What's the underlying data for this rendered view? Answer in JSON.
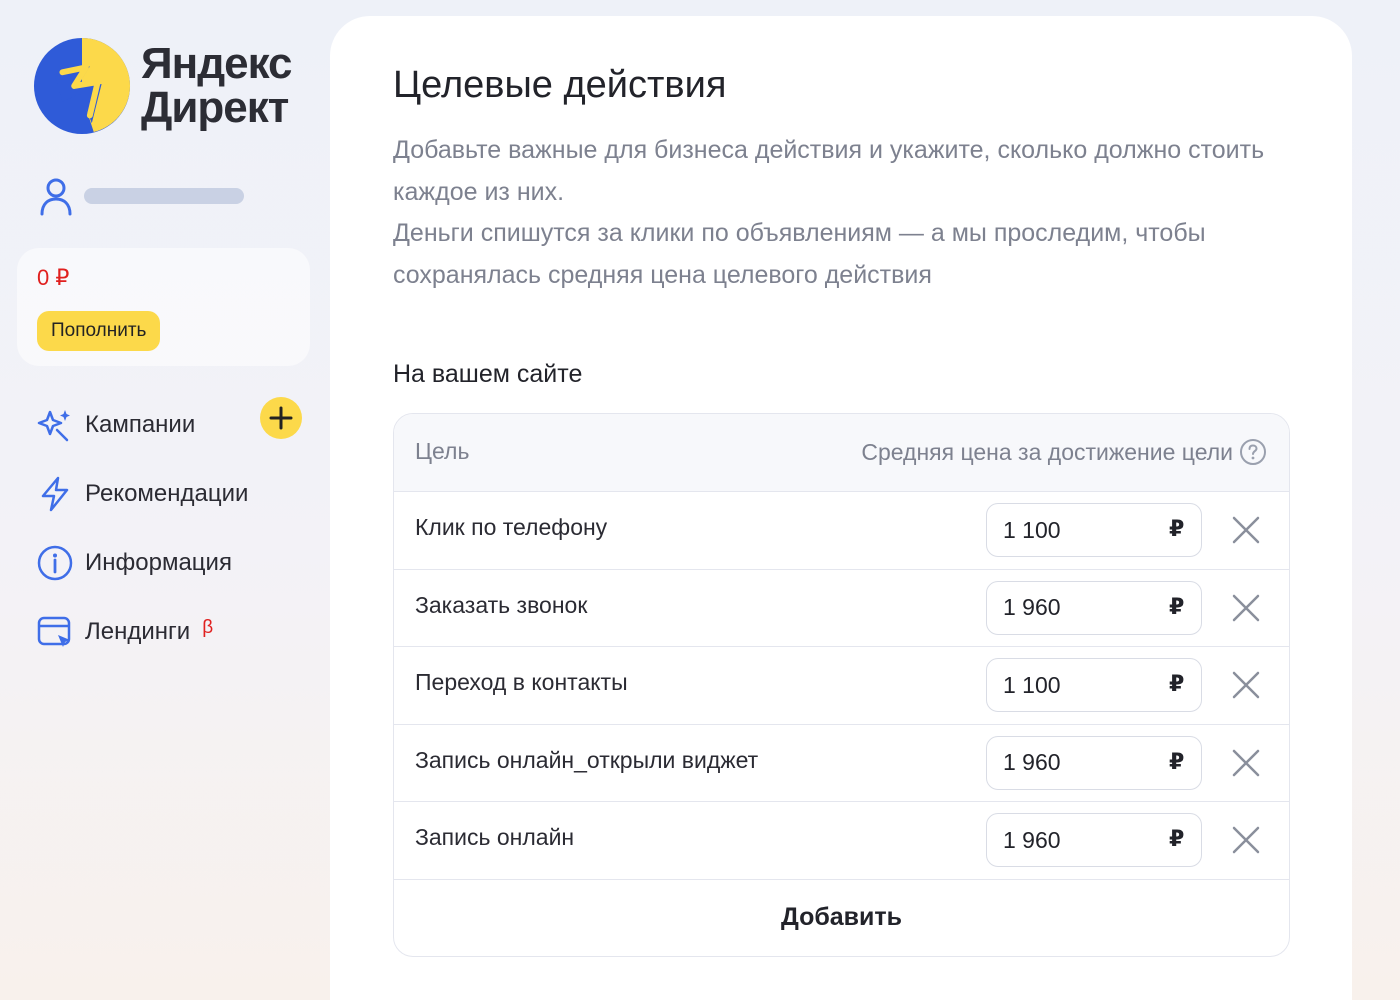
{
  "brand": {
    "line1": "Яндекс",
    "line2": "Директ"
  },
  "account": {
    "balance": "0 ₽",
    "topup_label": "Пополнить"
  },
  "nav": {
    "items": [
      {
        "label": "Кампании",
        "icon": "sparkle-stars-icon"
      },
      {
        "label": "Рекомендации",
        "icon": "lightning-icon"
      },
      {
        "label": "Информация",
        "icon": "info-circle-icon"
      },
      {
        "label": "Лендинги",
        "icon": "landing-page-icon",
        "badge": "β"
      }
    ]
  },
  "page": {
    "title": "Целевые действия",
    "description": [
      "Добавьте важные для бизнеса действия и укажите, сколько должно стоить каждое из них.",
      "Деньги спишутся за клики по объявлениям — а мы проследим, чтобы сохранялась средняя цена целевого действия"
    ],
    "section_title": "На вашем сайте"
  },
  "goals_table": {
    "headers": {
      "goal": "Цель",
      "price": "Средняя цена за достижение цели"
    },
    "currency": "₽",
    "rows": [
      {
        "goal": "Клик по телефону",
        "price": "1 100"
      },
      {
        "goal": "Заказать звонок",
        "price": "1 960"
      },
      {
        "goal": "Переход в контакты",
        "price": "1 100"
      },
      {
        "goal": "Запись онлайн_открыли виджет",
        "price": "1 960"
      },
      {
        "goal": "Запись онлайн",
        "price": "1 960"
      }
    ],
    "add_label": "Добавить"
  },
  "colors": {
    "accent_yellow": "#fcd94a",
    "brand_blue": "#2f5bd8",
    "balance_red": "#e0201f",
    "muted_text": "#7d818f"
  }
}
